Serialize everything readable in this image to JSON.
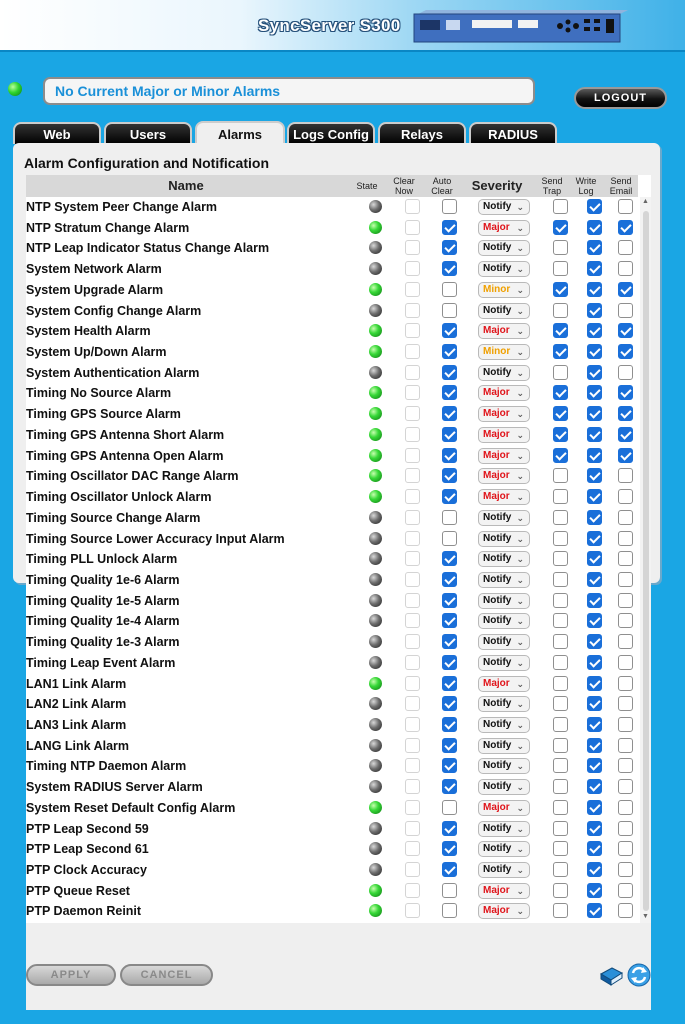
{
  "header": {
    "product": "SyncServer S300"
  },
  "status": {
    "message": "No Current Major or Minor Alarms",
    "logout_label": "LOGOUT"
  },
  "tabs": [
    {
      "label": "Web",
      "active": false
    },
    {
      "label": "Users",
      "active": false
    },
    {
      "label": "Alarms",
      "active": true
    },
    {
      "label": "Logs Config",
      "active": false
    },
    {
      "label": "Relays",
      "active": false
    },
    {
      "label": "RADIUS",
      "active": false
    }
  ],
  "panel": {
    "title": "Alarm Configuration and Notification"
  },
  "columns": {
    "name": "Name",
    "state": "State",
    "clear_now": "Clear Now",
    "auto_clear": "Auto Clear",
    "severity": "Severity",
    "send_trap": "Send Trap",
    "write_log": "Write Log",
    "send_email": "Send Email"
  },
  "colors": {
    "major": "#e0141a",
    "minor": "#f0a000",
    "notify": "#111111",
    "checkbox": "#1a6fd9"
  },
  "alarms": [
    {
      "name": "NTP System Peer Change Alarm",
      "state": "gray",
      "auto_clear": false,
      "severity": "Notify",
      "send_trap": false,
      "write_log": true,
      "send_email": false
    },
    {
      "name": "NTP Stratum Change Alarm",
      "state": "green",
      "auto_clear": true,
      "severity": "Major",
      "send_trap": true,
      "write_log": true,
      "send_email": true
    },
    {
      "name": "NTP Leap Indicator Status Change Alarm",
      "state": "gray",
      "auto_clear": true,
      "severity": "Notify",
      "send_trap": false,
      "write_log": true,
      "send_email": false
    },
    {
      "name": "System Network Alarm",
      "state": "gray",
      "auto_clear": true,
      "severity": "Notify",
      "send_trap": false,
      "write_log": true,
      "send_email": false
    },
    {
      "name": "System Upgrade Alarm",
      "state": "green",
      "auto_clear": false,
      "severity": "Minor",
      "send_trap": true,
      "write_log": true,
      "send_email": true
    },
    {
      "name": "System Config Change Alarm",
      "state": "gray",
      "auto_clear": false,
      "severity": "Notify",
      "send_trap": false,
      "write_log": true,
      "send_email": false
    },
    {
      "name": "System  Health Alarm",
      "state": "green",
      "auto_clear": true,
      "severity": "Major",
      "send_trap": true,
      "write_log": true,
      "send_email": true
    },
    {
      "name": "System Up/Down Alarm",
      "state": "green",
      "auto_clear": true,
      "severity": "Minor",
      "send_trap": true,
      "write_log": true,
      "send_email": true
    },
    {
      "name": "System Authentication Alarm",
      "state": "gray",
      "auto_clear": true,
      "severity": "Notify",
      "send_trap": false,
      "write_log": true,
      "send_email": false
    },
    {
      "name": "Timing No Source Alarm",
      "state": "green",
      "auto_clear": true,
      "severity": "Major",
      "send_trap": true,
      "write_log": true,
      "send_email": true
    },
    {
      "name": "Timing GPS Source Alarm",
      "state": "green",
      "auto_clear": true,
      "severity": "Major",
      "send_trap": true,
      "write_log": true,
      "send_email": true
    },
    {
      "name": "Timing GPS Antenna Short Alarm",
      "state": "green",
      "auto_clear": true,
      "severity": "Major",
      "send_trap": true,
      "write_log": true,
      "send_email": true
    },
    {
      "name": "Timing GPS Antenna Open Alarm",
      "state": "green",
      "auto_clear": true,
      "severity": "Major",
      "send_trap": true,
      "write_log": true,
      "send_email": true
    },
    {
      "name": "Timing Oscillator DAC Range Alarm",
      "state": "green",
      "auto_clear": true,
      "severity": "Major",
      "send_trap": false,
      "write_log": true,
      "send_email": false
    },
    {
      "name": "Timing Oscillator Unlock Alarm",
      "state": "green",
      "auto_clear": true,
      "severity": "Major",
      "send_trap": false,
      "write_log": true,
      "send_email": false
    },
    {
      "name": "Timing Source Change Alarm",
      "state": "gray",
      "auto_clear": false,
      "severity": "Notify",
      "send_trap": false,
      "write_log": true,
      "send_email": false
    },
    {
      "name": "Timing Source Lower Accuracy Input Alarm",
      "state": "gray",
      "auto_clear": false,
      "severity": "Notify",
      "send_trap": false,
      "write_log": true,
      "send_email": false
    },
    {
      "name": "Timing PLL Unlock Alarm",
      "state": "gray",
      "auto_clear": true,
      "severity": "Notify",
      "send_trap": false,
      "write_log": true,
      "send_email": false
    },
    {
      "name": "Timing Quality 1e-6 Alarm",
      "state": "gray",
      "auto_clear": true,
      "severity": "Notify",
      "send_trap": false,
      "write_log": true,
      "send_email": false
    },
    {
      "name": "Timing Quality 1e-5 Alarm",
      "state": "gray",
      "auto_clear": true,
      "severity": "Notify",
      "send_trap": false,
      "write_log": true,
      "send_email": false
    },
    {
      "name": "Timing Quality 1e-4 Alarm",
      "state": "gray",
      "auto_clear": true,
      "severity": "Notify",
      "send_trap": false,
      "write_log": true,
      "send_email": false
    },
    {
      "name": "Timing Quality 1e-3 Alarm",
      "state": "gray",
      "auto_clear": true,
      "severity": "Notify",
      "send_trap": false,
      "write_log": true,
      "send_email": false
    },
    {
      "name": "Timing Leap Event Alarm",
      "state": "gray",
      "auto_clear": true,
      "severity": "Notify",
      "send_trap": false,
      "write_log": true,
      "send_email": false
    },
    {
      "name": "LAN1 Link Alarm",
      "state": "green",
      "auto_clear": true,
      "severity": "Major",
      "send_trap": false,
      "write_log": true,
      "send_email": false
    },
    {
      "name": "LAN2 Link Alarm",
      "state": "gray",
      "auto_clear": true,
      "severity": "Notify",
      "send_trap": false,
      "write_log": true,
      "send_email": false
    },
    {
      "name": "LAN3 Link Alarm",
      "state": "gray",
      "auto_clear": true,
      "severity": "Notify",
      "send_trap": false,
      "write_log": true,
      "send_email": false
    },
    {
      "name": "LANG Link Alarm",
      "state": "gray",
      "auto_clear": true,
      "severity": "Notify",
      "send_trap": false,
      "write_log": true,
      "send_email": false
    },
    {
      "name": "Timing NTP Daemon Alarm",
      "state": "gray",
      "auto_clear": true,
      "severity": "Notify",
      "send_trap": false,
      "write_log": true,
      "send_email": false
    },
    {
      "name": "System RADIUS Server Alarm",
      "state": "gray",
      "auto_clear": true,
      "severity": "Notify",
      "send_trap": false,
      "write_log": true,
      "send_email": false
    },
    {
      "name": "System Reset Default Config Alarm",
      "state": "green",
      "auto_clear": false,
      "severity": "Major",
      "send_trap": false,
      "write_log": true,
      "send_email": false
    },
    {
      "name": "PTP Leap Second 59",
      "state": "gray",
      "auto_clear": true,
      "severity": "Notify",
      "send_trap": false,
      "write_log": true,
      "send_email": false
    },
    {
      "name": "PTP Leap Second 61",
      "state": "gray",
      "auto_clear": true,
      "severity": "Notify",
      "send_trap": false,
      "write_log": true,
      "send_email": false
    },
    {
      "name": "PTP Clock Accuracy",
      "state": "gray",
      "auto_clear": true,
      "severity": "Notify",
      "send_trap": false,
      "write_log": true,
      "send_email": false
    },
    {
      "name": "PTP Queue Reset",
      "state": "green",
      "auto_clear": false,
      "severity": "Major",
      "send_trap": false,
      "write_log": true,
      "send_email": false
    },
    {
      "name": "PTP Daemon Reinit",
      "state": "green",
      "auto_clear": false,
      "severity": "Major",
      "send_trap": false,
      "write_log": true,
      "send_email": false
    }
  ],
  "actions": {
    "apply_label": "APPLY",
    "cancel_label": "CANCEL"
  },
  "icons": {
    "help": "help-book-icon",
    "refresh": "refresh-icon"
  }
}
